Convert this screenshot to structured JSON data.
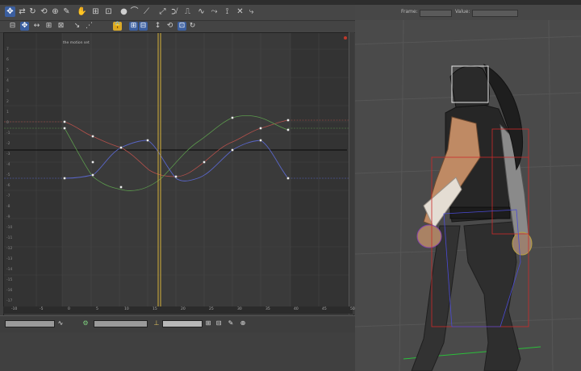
{
  "graph": {
    "title": "Curve representation of the motion set",
    "y_labels": [
      "7",
      "6",
      "5",
      "4",
      "3",
      "2",
      "1",
      "0",
      "-1",
      "-2",
      "-3",
      "-4",
      "-5",
      "-6",
      "-7",
      "-8",
      "-9",
      "-10",
      "-11",
      "-12",
      "-13",
      "-14",
      "-15",
      "-16",
      "-17"
    ],
    "ruler_labels": [
      "-10",
      "-5",
      "0",
      "5",
      "10",
      "15",
      "20",
      "25",
      "30",
      "35",
      "40",
      "45",
      "50"
    ]
  },
  "viewport": {
    "frame_label": "Frame:",
    "value_label": "Value:"
  },
  "colors": {
    "red_curve": "#b4504b",
    "green_curve": "#5c9a4d",
    "blue_curve": "#5966c8",
    "time_slider": "#d7b23a"
  }
}
